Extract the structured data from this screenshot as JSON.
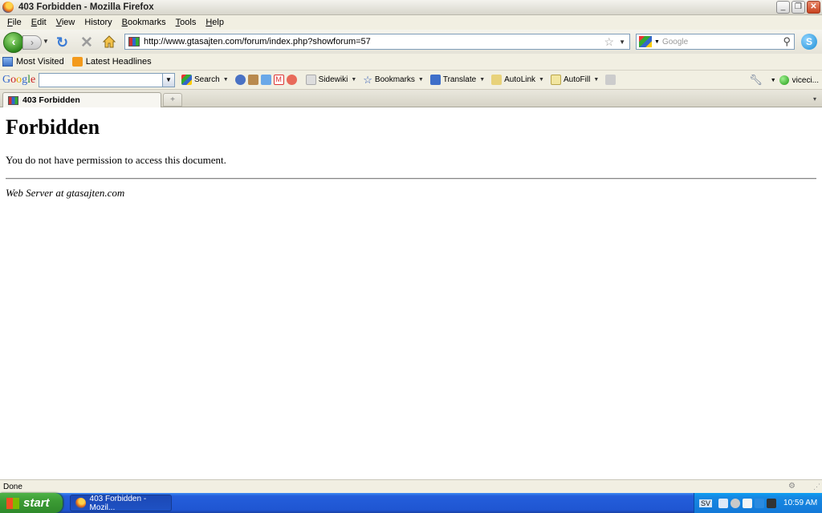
{
  "window": {
    "title": "403 Forbidden - Mozilla Firefox",
    "minimize": "_",
    "maximize": "❐",
    "close": "✕"
  },
  "menu": [
    {
      "label": "File",
      "key": "F",
      "rest": "ile"
    },
    {
      "label": "Edit",
      "key": "E",
      "rest": "dit"
    },
    {
      "label": "View",
      "key": "V",
      "rest": "iew"
    },
    {
      "label": "History",
      "key": "H",
      "rest": "istory"
    },
    {
      "label": "Bookmarks",
      "key": "B",
      "rest": "ookmarks"
    },
    {
      "label": "Tools",
      "key": "T",
      "rest": "ools"
    },
    {
      "label": "Help",
      "key": "H",
      "rest": "elp"
    }
  ],
  "nav": {
    "url": "http://www.gtasajten.com/forum/index.php?showforum=57",
    "search_placeholder": "Google"
  },
  "bookmarks": [
    {
      "label": "Most Visited",
      "icon": "most-visited-icon"
    },
    {
      "label": "Latest Headlines",
      "icon": "rss-icon"
    }
  ],
  "google_toolbar": {
    "search_label": "Search",
    "sidewiki_label": "Sidewiki",
    "bookmarks_label": "Bookmarks",
    "translate_label": "Translate",
    "autolink_label": "AutoLink",
    "autofill_label": "AutoFill",
    "account_label": "viceci..."
  },
  "tabs": [
    {
      "label": "403 Forbidden",
      "active": true
    }
  ],
  "page": {
    "heading": "Forbidden",
    "message": "You do not have permission to access this document.",
    "address": "Web Server at gtasajten.com"
  },
  "status": {
    "text": "Done"
  },
  "taskbar": {
    "start_label": "start",
    "items": [
      {
        "label": "403 Forbidden - Mozil..."
      }
    ],
    "language": "SV",
    "clock": "10:59 AM"
  },
  "colors": {
    "taskbar_blue": "#245edb",
    "start_green": "#3c9b34",
    "chrome_bg": "#f1efe2"
  }
}
